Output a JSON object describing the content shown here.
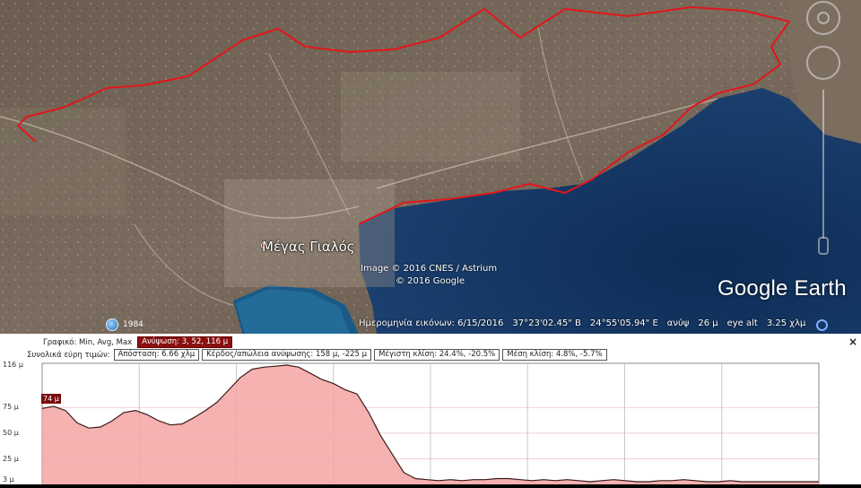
{
  "map": {
    "place_name": "Μέγας Γιαλός",
    "imagery_credit": "Image © 2016 CNES / Astrium",
    "copyright": "© 2016 Google",
    "logo_text": "Google Earth",
    "historical_year": "1984",
    "track_color": "#e3161b"
  },
  "status_bar": {
    "imagery_date": "Ημερομηνία εικόνων: 6/15/2016",
    "latitude": "37°23'02.45\" B",
    "longitude": "24°55'05.94\" E",
    "elevation_label": "ανύψ",
    "elevation_value": "26 μ",
    "eye_alt_label": "eye alt",
    "eye_alt_value": "3.25 χλμ"
  },
  "elevation_panel": {
    "graph_label": "Γραφικό: Min, Avg, Max",
    "hover_stat": "Ανύψωση: 3, 52, 116 μ",
    "range_label": "Συνολικά εύρη τιμών:",
    "distance": "Απόσταση: 6.66 χλμ",
    "gain_loss": "Κέρδος/απώλεια ανύψωσης: 158 μ, -225 μ",
    "max_slope": "Μέγιστη κλίση: 24.4%, -20.5%",
    "avg_slope": "Μέση κλίση: 4.8%, -5.7%",
    "close_label": "×",
    "flag_value": "74 μ",
    "fill_color": "#f4a3a3",
    "line_color": "#3a1b1b"
  },
  "chart_data": {
    "type": "area",
    "y_tick_labels": [
      "116 μ",
      "75 μ",
      "50 μ",
      "25 μ",
      "3 μ"
    ],
    "ylim": [
      3,
      116
    ],
    "x": [
      0,
      0.1,
      0.2,
      0.3,
      0.4,
      0.5,
      0.6,
      0.7,
      0.8,
      0.9,
      1.0,
      1.1,
      1.2,
      1.3,
      1.4,
      1.5,
      1.6,
      1.7,
      1.8,
      1.9,
      2.0,
      2.1,
      2.2,
      2.3,
      2.4,
      2.5,
      2.6,
      2.7,
      2.8,
      2.9,
      3.0,
      3.1,
      3.2,
      3.3,
      3.4,
      3.5,
      3.6,
      3.7,
      3.8,
      3.9,
      4.0,
      4.1,
      4.2,
      4.3,
      4.4,
      4.5,
      4.6,
      4.7,
      4.8,
      4.9,
      5.0,
      5.1,
      5.2,
      5.3,
      5.4,
      5.5,
      5.6,
      5.7,
      5.8,
      5.9,
      6.0,
      6.1,
      6.2,
      6.3,
      6.4,
      6.5,
      6.66
    ],
    "values": [
      74,
      76,
      72,
      60,
      55,
      56,
      62,
      70,
      72,
      68,
      62,
      58,
      59,
      65,
      72,
      80,
      92,
      104,
      112,
      114,
      115,
      116,
      114,
      108,
      102,
      98,
      92,
      88,
      70,
      48,
      30,
      12,
      6,
      5,
      4,
      5,
      4,
      5,
      5,
      6,
      6,
      5,
      4,
      5,
      4,
      5,
      4,
      3,
      4,
      5,
      4,
      3,
      3,
      4,
      4,
      5,
      4,
      3,
      3,
      4,
      3,
      3,
      3,
      3,
      3,
      3,
      3
    ],
    "grid": true
  }
}
